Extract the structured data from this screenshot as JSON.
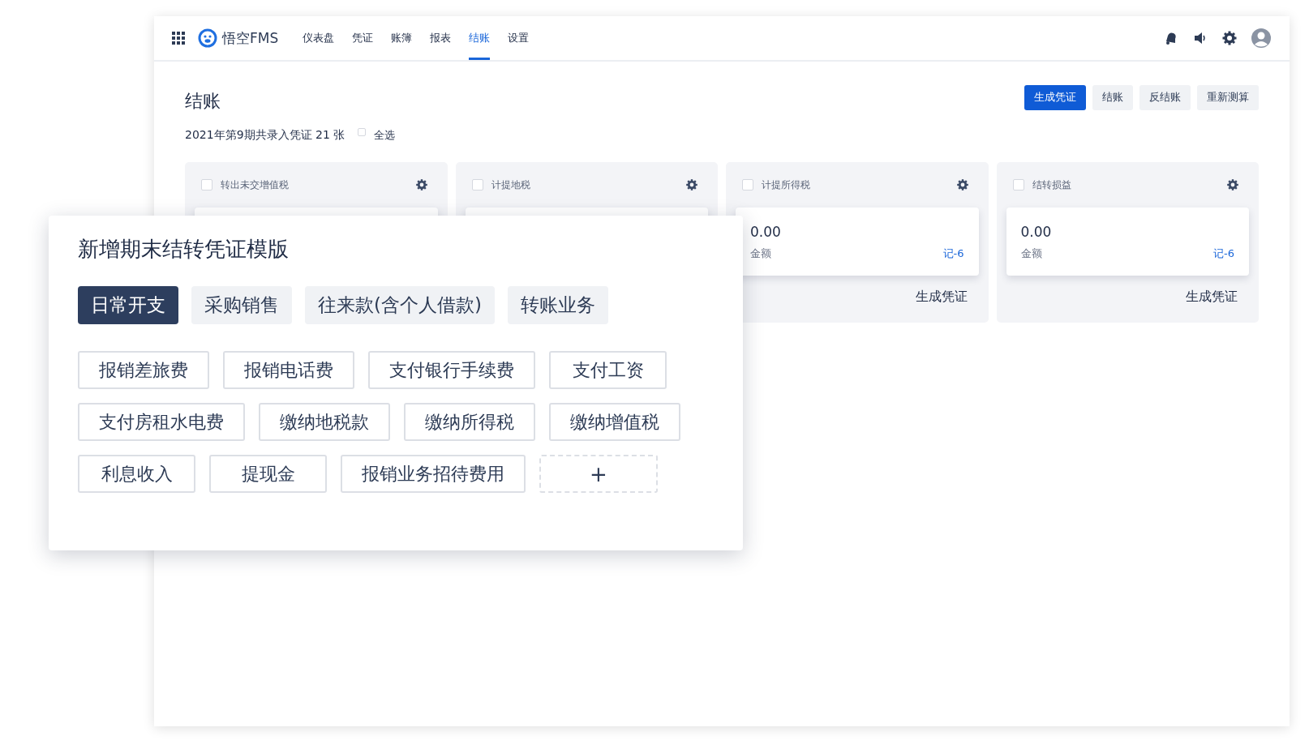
{
  "app": {
    "name": "悟空FMS"
  },
  "nav": [
    {
      "label": "仪表盘",
      "selected": false
    },
    {
      "label": "凭证",
      "selected": false
    },
    {
      "label": "账簿",
      "selected": false
    },
    {
      "label": "报表",
      "selected": false
    },
    {
      "label": "结账",
      "selected": true
    },
    {
      "label": "设置",
      "selected": false
    }
  ],
  "page": {
    "title": "结账",
    "summary": "2021年第9期共录入凭证 21 张",
    "select_all": {
      "label": "全选",
      "checked": false
    }
  },
  "actions": [
    {
      "label": "生成凭证",
      "kind": "primary"
    },
    {
      "label": "结账",
      "kind": "default"
    },
    {
      "label": "反结账",
      "kind": "default"
    },
    {
      "label": "重新测算",
      "kind": "default"
    }
  ],
  "cards": [
    {
      "title": "转出未交增值税",
      "checked": false
    },
    {
      "title": "计提地税",
      "checked": false
    },
    {
      "title": "计提所得税",
      "checked": false,
      "amount": "0.00",
      "amount_label": "金额",
      "voucher": "记-6",
      "action": "生成凭证"
    },
    {
      "title": "结转损益",
      "checked": false,
      "amount": "0.00",
      "amount_label": "金额",
      "voucher": "记-6",
      "action": "生成凭证"
    }
  ],
  "dialog": {
    "title": "新增期末结转凭证模版",
    "tabs": [
      {
        "label": "日常开支",
        "selected": true
      },
      {
        "label": "采购销售",
        "selected": false
      },
      {
        "label": "往来款(含个人借款)",
        "selected": false
      },
      {
        "label": "转账业务",
        "selected": false
      }
    ],
    "templates": [
      [
        "报销差旅费",
        "报销电话费",
        "支付银行手续费",
        "支付工资"
      ],
      [
        "支付房租水电费",
        "缴纳地税款",
        "缴纳所得税",
        "缴纳增值税"
      ],
      [
        "利息收入",
        "提现金",
        "报销业务招待费用"
      ]
    ],
    "add_button": "+"
  }
}
